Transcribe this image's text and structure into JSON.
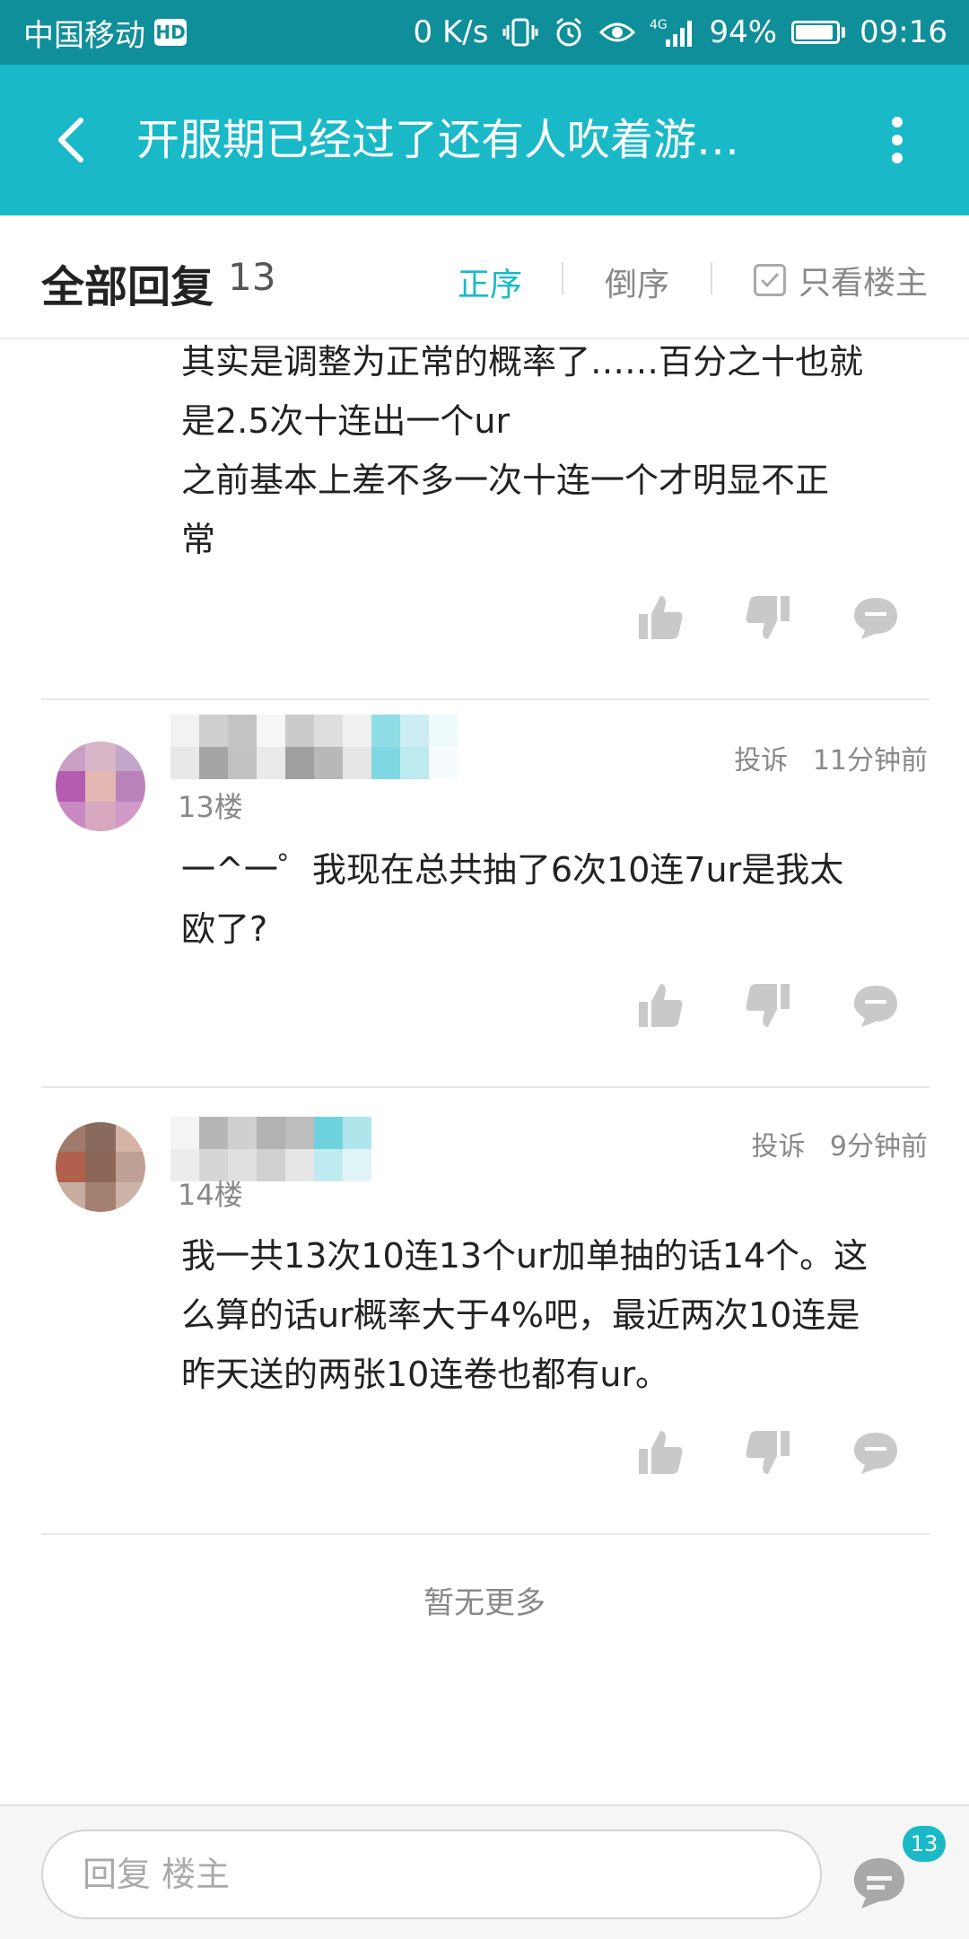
{
  "status_bar": {
    "carrier": "中国移动",
    "hd_badge": "HD",
    "net_speed": "0 K/s",
    "network": "4G",
    "battery": "94%",
    "battery_level": 0.94,
    "time": "09:16"
  },
  "header": {
    "title": "开服期已经过了还有人吹着游…"
  },
  "replies_header": {
    "title": "全部回复",
    "count": "13",
    "sort_asc": "正序",
    "sort_desc": "倒序",
    "only_op": "只看楼主"
  },
  "replies": [
    {
      "lines": [
        "其实是调整为正常的概率了……百分之十也就",
        "是2.5次十连出一个ur",
        "之前基本上差不多一次十连一个才明显不正",
        "常"
      ]
    },
    {
      "floor": "13楼",
      "report": "投诉",
      "time": "11分钟前",
      "lines": [
        "一^一゜我现在总共抽了6次10连7ur是我太",
        "欧了?"
      ]
    },
    {
      "floor": "14楼",
      "report": "投诉",
      "time": "9分钟前",
      "lines": [
        "我一共13次10连13个ur加单抽的话14个。这",
        "么算的话ur概率大于4%吧，最近两次10连是",
        "昨天送的两张10连卷也都有ur。"
      ]
    }
  ],
  "no_more": "暂无更多",
  "bottom_bar": {
    "placeholder": "回复  楼主",
    "comment_count": "13"
  },
  "colors": {
    "status_bar": "#0f8f99",
    "title_bar": "#19b9c7",
    "accent": "#19b9c7",
    "icon_gray": "#c9c9c9"
  }
}
